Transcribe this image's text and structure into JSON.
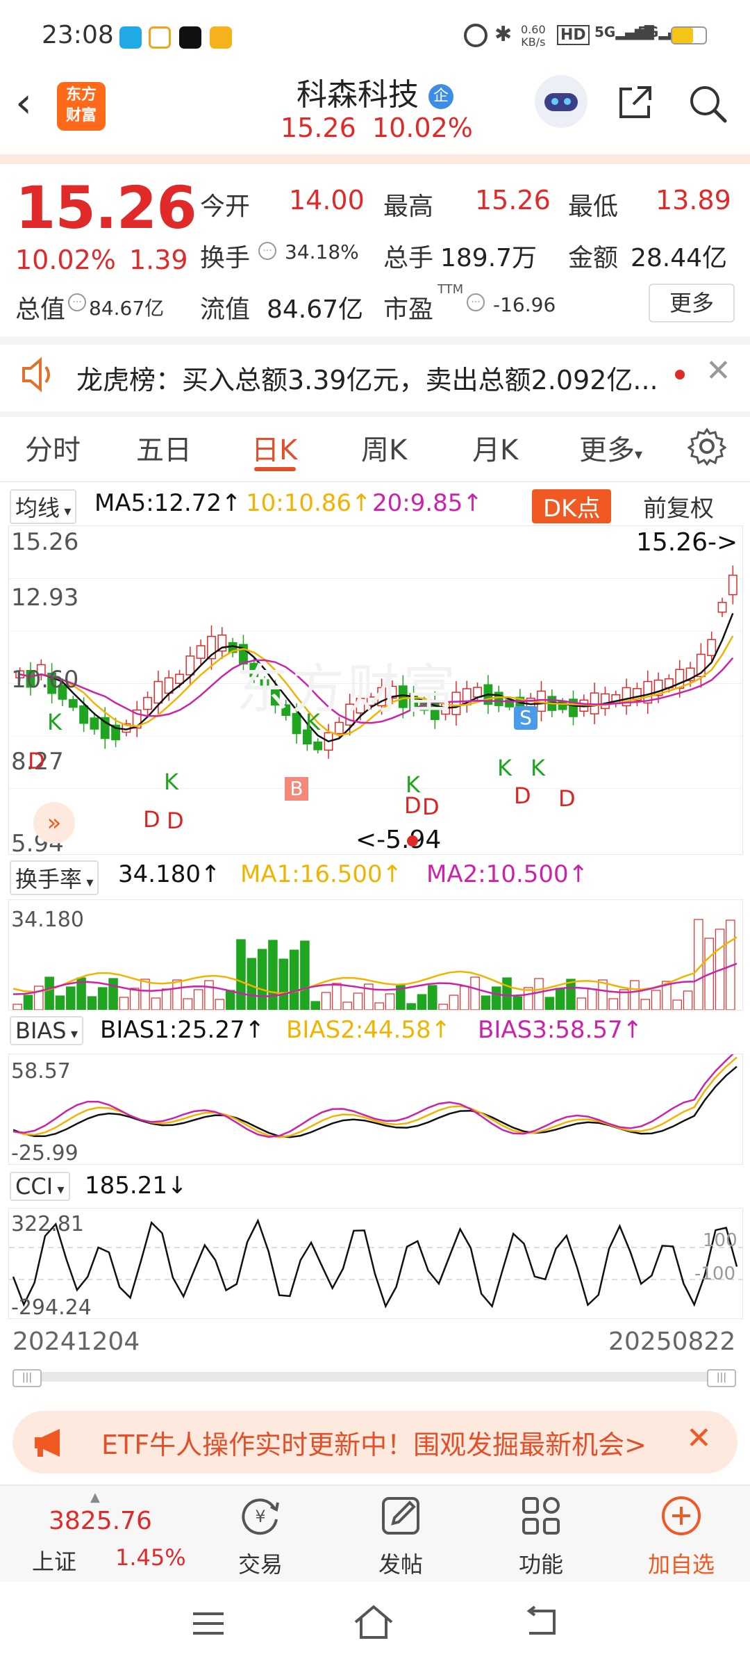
{
  "status_bar": {
    "time": "23:08",
    "net_speed_top": "0.60",
    "net_speed_bottom": "KB/s",
    "hd": "HD",
    "sig1": "5G",
    "sig2": "5G"
  },
  "header": {
    "logo_line1": "东方",
    "logo_line2": "财富",
    "title": "科森科技",
    "badge": "企",
    "price": "15.26",
    "change_pct": "10.02%"
  },
  "quote": {
    "price": "15.26",
    "change_pct": "10.02%",
    "change_abs": "1.39",
    "open_label": "今开",
    "open_value": "14.00",
    "high_label": "最高",
    "high_value": "15.26",
    "low_label": "最低",
    "low_value": "13.89",
    "turnover_label": "换手",
    "turnover_value": "34.18%",
    "volume_label": "总手",
    "volume_value": "189.7万",
    "amount_label": "金额",
    "amount_value": "28.44亿",
    "mktcap_label": "总值",
    "mktcap_value": "84.67亿",
    "float_label": "流值",
    "float_value": "84.67亿",
    "pe_label": "市盈",
    "pe_sup": "TTM",
    "pe_value": "-16.96",
    "more_button": "更多"
  },
  "notice": {
    "text": "龙虎榜：买入总额3.39亿元，卖出总额2.092亿..."
  },
  "tabs": {
    "items": [
      "分时",
      "五日",
      "日K",
      "周K",
      "月K",
      "更多"
    ],
    "active": "日K"
  },
  "main_chart": {
    "indicator_select": "均线",
    "ma5": "MA5:12.72",
    "ma10": "10:10.86",
    "ma20": "20:9.85",
    "dk_button": "DK点",
    "adjust_button": "前复权",
    "y_labels": [
      "15.26",
      "12.93",
      "10.60",
      "8.27",
      "5.94"
    ],
    "last_price_label": "15.26->",
    "low_label": "<-5.94",
    "watermark": "东方财富",
    "signals": {
      "B": "B",
      "S": "S",
      "K": "K",
      "D": "D"
    }
  },
  "turnover_chart": {
    "select": "换手率",
    "value": "34.180",
    "ma1": "MA1:16.500",
    "ma2": "MA2:10.500",
    "y_top": "34.180"
  },
  "bias_chart": {
    "select": "BIAS",
    "bias1": "BIAS1:25.27",
    "bias2": "BIAS2:44.58",
    "bias3": "BIAS3:58.57",
    "y_top": "58.57",
    "y_bottom": "-25.99"
  },
  "cci_chart": {
    "select": "CCI",
    "value": "185.21",
    "y_top": "322.81",
    "y_bottom": "-294.24",
    "ref_high": "100",
    "ref_low": "-100"
  },
  "date_range": {
    "start": "20241204",
    "end": "20250822"
  },
  "banner": {
    "text": "ETF牛人操作实时更新中！围观发掘最新机会>"
  },
  "bottom_nav": {
    "index_value": "3825.76",
    "index_name": "上证",
    "index_change": "1.45%",
    "trade": "交易",
    "post": "发帖",
    "functions": "功能",
    "add_watch": "加自选"
  },
  "colors": {
    "up_red": "#e02a2a",
    "down_green": "#1fa51f",
    "ma5": "#111111",
    "ma10": "#f0b400",
    "ma20": "#cc22aa",
    "accent": "#f05a22"
  }
}
